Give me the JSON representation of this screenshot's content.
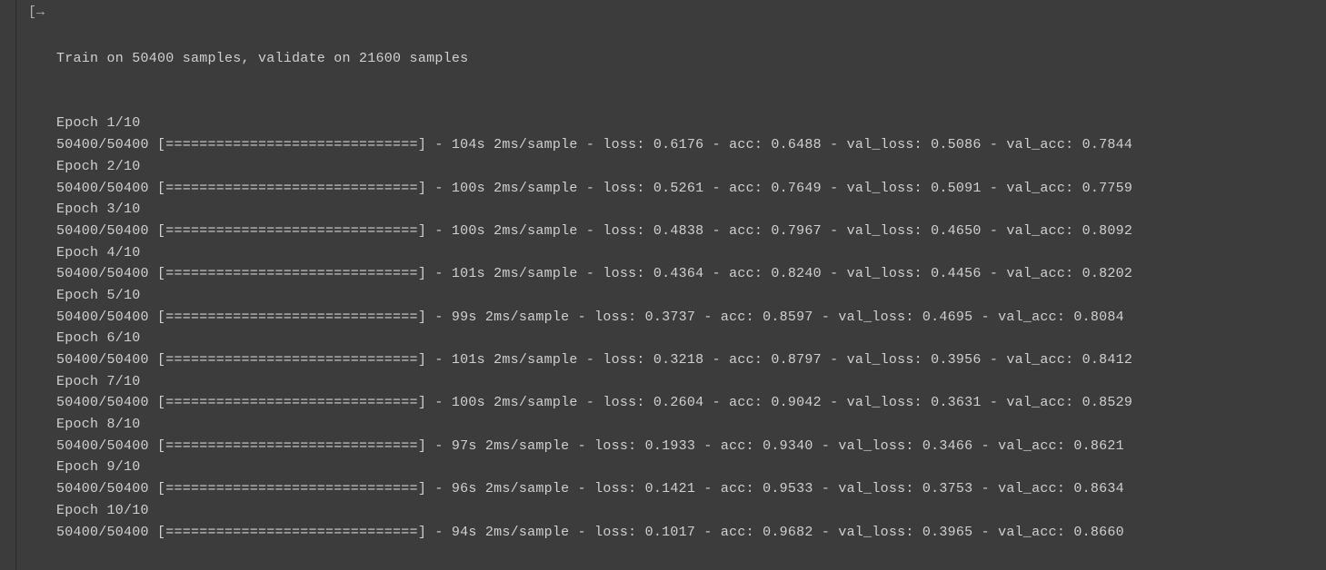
{
  "training": {
    "header": "Train on 50400 samples, validate on 21600 samples",
    "progress_bar": "[==============================]",
    "samples_total": 50400,
    "validate_total": 21600,
    "total_epochs": 10,
    "epochs": [
      {
        "epoch": 1,
        "done": 50400,
        "total": 50400,
        "time": "104s",
        "rate": "2ms/sample",
        "loss": "0.6176",
        "acc": "0.6488",
        "val_loss": "0.5086",
        "val_acc": "0.7844"
      },
      {
        "epoch": 2,
        "done": 50400,
        "total": 50400,
        "time": "100s",
        "rate": "2ms/sample",
        "loss": "0.5261",
        "acc": "0.7649",
        "val_loss": "0.5091",
        "val_acc": "0.7759"
      },
      {
        "epoch": 3,
        "done": 50400,
        "total": 50400,
        "time": "100s",
        "rate": "2ms/sample",
        "loss": "0.4838",
        "acc": "0.7967",
        "val_loss": "0.4650",
        "val_acc": "0.8092"
      },
      {
        "epoch": 4,
        "done": 50400,
        "total": 50400,
        "time": "101s",
        "rate": "2ms/sample",
        "loss": "0.4364",
        "acc": "0.8240",
        "val_loss": "0.4456",
        "val_acc": "0.8202"
      },
      {
        "epoch": 5,
        "done": 50400,
        "total": 50400,
        "time": "99s",
        "rate": "2ms/sample",
        "loss": "0.3737",
        "acc": "0.8597",
        "val_loss": "0.4695",
        "val_acc": "0.8084"
      },
      {
        "epoch": 6,
        "done": 50400,
        "total": 50400,
        "time": "101s",
        "rate": "2ms/sample",
        "loss": "0.3218",
        "acc": "0.8797",
        "val_loss": "0.3956",
        "val_acc": "0.8412"
      },
      {
        "epoch": 7,
        "done": 50400,
        "total": 50400,
        "time": "100s",
        "rate": "2ms/sample",
        "loss": "0.2604",
        "acc": "0.9042",
        "val_loss": "0.3631",
        "val_acc": "0.8529"
      },
      {
        "epoch": 8,
        "done": 50400,
        "total": 50400,
        "time": "97s",
        "rate": "2ms/sample",
        "loss": "0.1933",
        "acc": "0.9340",
        "val_loss": "0.3466",
        "val_acc": "0.8621"
      },
      {
        "epoch": 9,
        "done": 50400,
        "total": 50400,
        "time": "96s",
        "rate": "2ms/sample",
        "loss": "0.1421",
        "acc": "0.9533",
        "val_loss": "0.3753",
        "val_acc": "0.8634"
      },
      {
        "epoch": 10,
        "done": 50400,
        "total": 50400,
        "time": "94s",
        "rate": "2ms/sample",
        "loss": "0.1017",
        "acc": "0.9682",
        "val_loss": "0.3965",
        "val_acc": "0.8660"
      }
    ]
  },
  "icons": {
    "execute": "[→"
  }
}
